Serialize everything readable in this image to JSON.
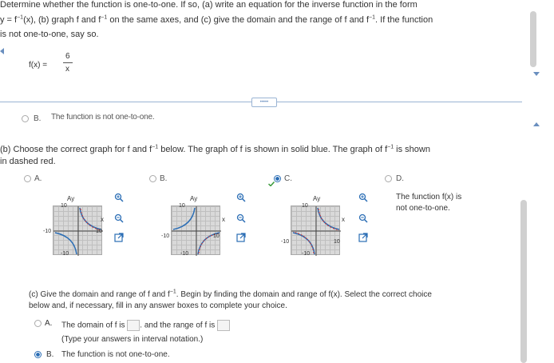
{
  "question": {
    "line1": "Determine whether the function is one-to-one. If so, (a) write an equation for the inverse function in the form",
    "line2a": "y = f",
    "line2_sup": "−1",
    "line2b": "(x), (b) graph f and f",
    "line2c": " on the same axes, and (c) give the domain and the range of f and f",
    "line2d": ". If the function",
    "line3": "is not one-to-one, say so.",
    "func_lhs": "f(x) =",
    "func_num": "6",
    "func_den": "x"
  },
  "part_a_option_b": {
    "letter": "B.",
    "text": "The function is not one-to-one."
  },
  "divider_label": "•••••",
  "part_b": {
    "prompt1a": "(b) Choose the correct graph for f and f",
    "prompt1b": " below. The graph of f is shown in solid blue. The graph of f",
    "prompt1c": " is shown",
    "prompt2": "in dashed red.",
    "options": [
      {
        "letter": "A.",
        "ticks": {
          "top": "10",
          "left": "-10",
          "right": "10",
          "bottom": "-10"
        }
      },
      {
        "letter": "B.",
        "ticks": {
          "top": "10",
          "left": "-10",
          "right": "10",
          "bottom": "-10"
        }
      },
      {
        "letter": "C.",
        "ticks": {
          "top": "10",
          "left": "-10",
          "right": "10",
          "bottom": "-10"
        }
      },
      {
        "letter": "D.",
        "text_line1": "The function f(x) is",
        "text_line2": "not one-to-one."
      }
    ],
    "axis_y": "Ay",
    "axis_x": "x"
  },
  "part_c": {
    "prompt1a": "(c) Give the domain and range of f and f",
    "prompt1b": ". Begin by finding the domain and range of f(x). Select the correct choice",
    "prompt2": "below and, if necessary, fill in any answer boxes to complete your choice.",
    "option_a": {
      "letter": "A.",
      "text1": "The domain of f is",
      "text2": ". and the range of f is",
      "hint": "(Type your answers in interval notation.)"
    },
    "option_b": {
      "letter": "B.",
      "text": "The function is not one-to-one."
    }
  },
  "colors": {
    "accent": "#2a6db5",
    "graph_bg": "#d9d9d9"
  }
}
